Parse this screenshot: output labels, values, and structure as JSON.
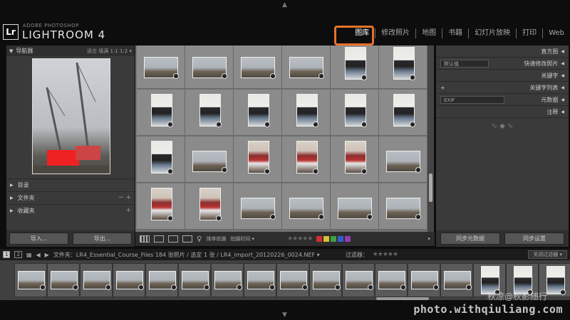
{
  "app": {
    "badge": "Lr",
    "brand_small": "ADOBE PHOTOSHOP",
    "brand_name": "LIGHTROOM 4"
  },
  "modules": [
    {
      "label": "图库",
      "active": true
    },
    {
      "label": "修改照片",
      "active": false
    },
    {
      "label": "地图",
      "active": false
    },
    {
      "label": "书籍",
      "active": false
    },
    {
      "label": "幻灯片放映",
      "active": false
    },
    {
      "label": "打印",
      "active": false
    },
    {
      "label": "Web",
      "active": false
    }
  ],
  "left_panel": {
    "navigator_title": "导航器",
    "navigator_options": "适合  填满  1:1  1:2 ▾",
    "sections": [
      {
        "label": "目录",
        "ctrl": ""
      },
      {
        "label": "文件夹",
        "ctrl": "−  +"
      },
      {
        "label": "收藏夹",
        "ctrl": "+"
      }
    ],
    "import_button": "导入...",
    "export_button": "导出..."
  },
  "toolbar": {
    "sort_label": "排序依据",
    "sort_value": "拍摄时间 ▾",
    "stars": "★★★★★",
    "color_labels": [
      "#d03030",
      "#d8c030",
      "#40a040",
      "#3060d0",
      "#9040b0"
    ]
  },
  "right_panel": {
    "histogram": "直方图",
    "quick_develop_preset": "默认值",
    "quick_develop": "快速修改照片",
    "keywording": "关键字",
    "keyword_list": "关键字列表",
    "metadata_preset": "EXIF",
    "metadata": "元数据",
    "comments": "注释",
    "sync_metadata_button": "同步元数据",
    "sync_settings_button": "同步设置"
  },
  "filmbar": {
    "screen1": "1",
    "screen2": "2",
    "path": "文件夹：LR4_Essential_Course_Files   184 张照片 / 选定 1 张 / LR4_import_20120226_0024.NEF ▾",
    "filter_label": "过滤器：",
    "filter_value": "关闭过滤器 ▾"
  },
  "watermark": {
    "line1": "秋凉@秋影随行",
    "line2": "photo.withqiuliang.com"
  }
}
